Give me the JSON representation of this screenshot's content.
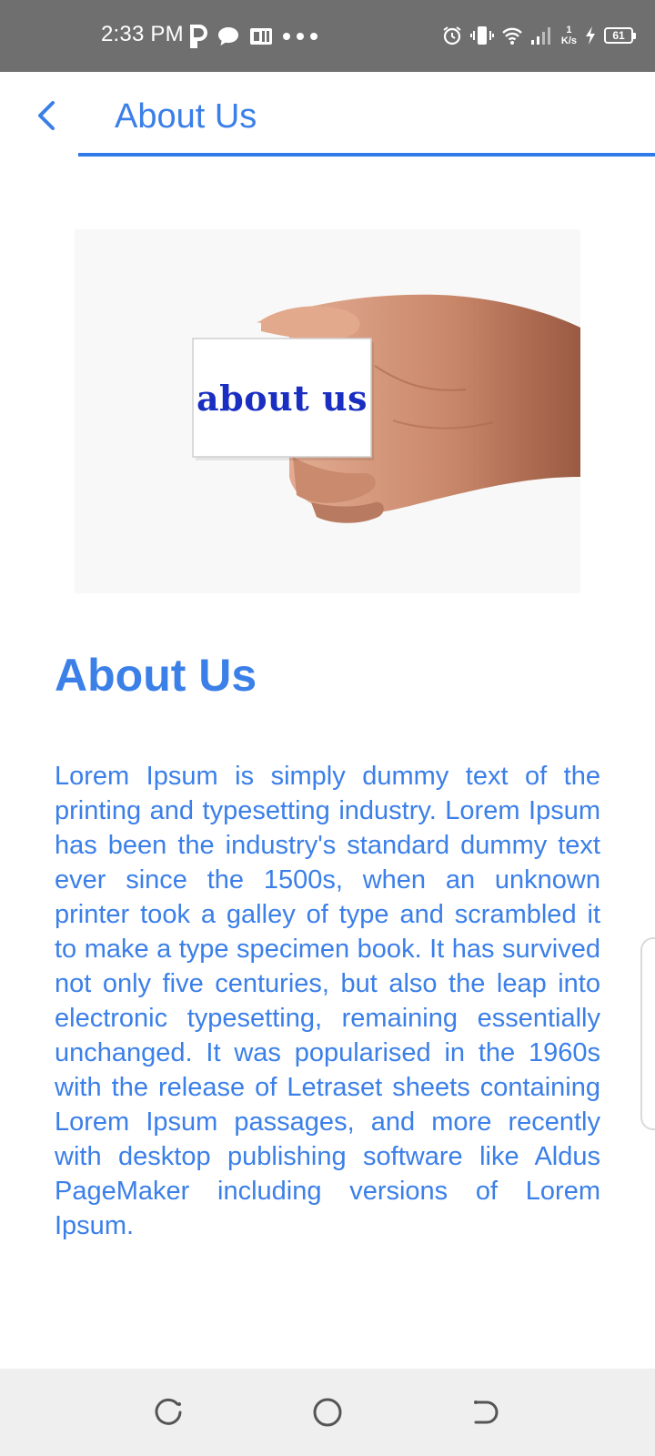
{
  "status_bar": {
    "time": "2:33 PM",
    "network_speed_value": "1",
    "network_speed_unit": "K/s",
    "battery_level": "61",
    "left_icons": [
      "parking-icon",
      "chat-bubble-icon",
      "office-app-icon",
      "more-dots-icon"
    ],
    "right_icons": [
      "alarm-icon",
      "vibrate-icon",
      "wifi-icon",
      "signal-icon",
      "charging-icon",
      "battery-icon"
    ]
  },
  "app_bar": {
    "back_icon": "chevron-left-icon",
    "title": "About Us"
  },
  "hero": {
    "card_text": "about us"
  },
  "content": {
    "heading": "About Us",
    "body": "Lorem Ipsum is simply dummy text of the printing and typesetting industry. Lorem Ipsum has been the industry's standard dummy text ever since the 1500s, when an unknown printer took a galley of type and scrambled it to make a type specimen book. It has survived not only five centuries, but also the leap into electronic typesetting, remaining essentially unchanged. It was popularised in the 1960s with the release of Letraset sheets containing Lorem Ipsum passages, and more recently with desktop publishing software like Aldus PageMaker including versions of Lorem Ipsum."
  },
  "nav_bar": {
    "buttons": [
      "recents-icon",
      "home-icon",
      "back-icon"
    ]
  },
  "colors": {
    "accent": "#3b7fe8",
    "status_bar": "#6f6f6f",
    "nav_bar": "#efefef",
    "card_text": "#1a2fc2"
  }
}
